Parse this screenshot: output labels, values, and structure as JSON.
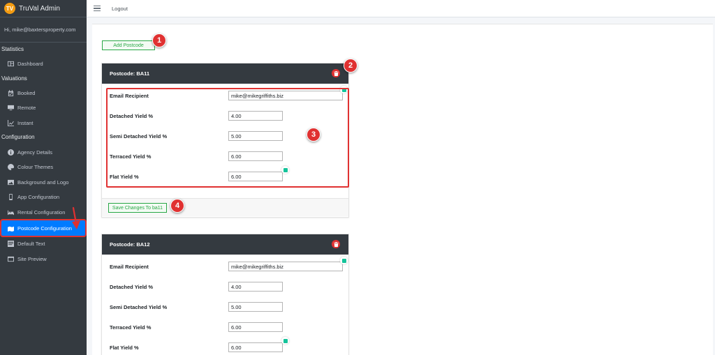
{
  "brand": {
    "logo_text": "TV",
    "title": "TruVal Admin"
  },
  "user": {
    "greeting": "Hi, mike@baxtersproperty.com"
  },
  "sidebar": {
    "sections": [
      {
        "header": "Statistics",
        "items": [
          {
            "label": "Dashboard",
            "icon": "dashboard-icon"
          }
        ]
      },
      {
        "header": "Valuations",
        "items": [
          {
            "label": "Booked",
            "icon": "calendar-check-icon"
          },
          {
            "label": "Remote",
            "icon": "desktop-icon"
          },
          {
            "label": "Instant",
            "icon": "chart-icon"
          }
        ]
      },
      {
        "header": "Configuration",
        "items": [
          {
            "label": "Agency Details",
            "icon": "info-icon"
          },
          {
            "label": "Colour Themes",
            "icon": "palette-icon"
          },
          {
            "label": "Background and Logo",
            "icon": "image-icon"
          },
          {
            "label": "App Configuration",
            "icon": "mobile-icon"
          },
          {
            "label": "Rental Configuration",
            "icon": "bed-icon"
          },
          {
            "label": "Postcode Configuration",
            "icon": "map-icon",
            "active": true
          },
          {
            "label": "Default Text",
            "icon": "text-icon"
          },
          {
            "label": "Site Preview",
            "icon": "preview-icon"
          }
        ]
      }
    ]
  },
  "topbar": {
    "logout_label": "Logout"
  },
  "main": {
    "add_postcode_label": "Add Postcode",
    "cards": [
      {
        "title": "Postcode: BA11",
        "fields": {
          "email": {
            "label": "Email Recipient",
            "value": "mike@mikegriffiths.biz"
          },
          "detached": {
            "label": "Detached Yield %",
            "value": "4.00"
          },
          "semi": {
            "label": "Semi Detached Yield %",
            "value": "5.00"
          },
          "terraced": {
            "label": "Terraced Yield %",
            "value": "6.00"
          },
          "flat": {
            "label": "Flat Yield %",
            "value": "6.00"
          }
        },
        "save_label": "Save Changes To ba11"
      },
      {
        "title": "Postcode: BA12",
        "fields": {
          "email": {
            "label": "Email Recipient",
            "value": "mike@mikegriffiths.biz"
          },
          "detached": {
            "label": "Detached Yield %",
            "value": "4.00"
          },
          "semi": {
            "label": "Semi Detached Yield %",
            "value": "5.00"
          },
          "terraced": {
            "label": "Terraced Yield %",
            "value": "6.00"
          },
          "flat": {
            "label": "Flat Yield %",
            "value": "6.00"
          }
        }
      }
    ]
  },
  "callouts": {
    "c1": "1",
    "c2": "2",
    "c3": "3",
    "c4": "4"
  },
  "colors": {
    "accent": "#007bff",
    "sidebar_bg": "#343a40",
    "callout": "#e03131",
    "success": "#28a745"
  }
}
